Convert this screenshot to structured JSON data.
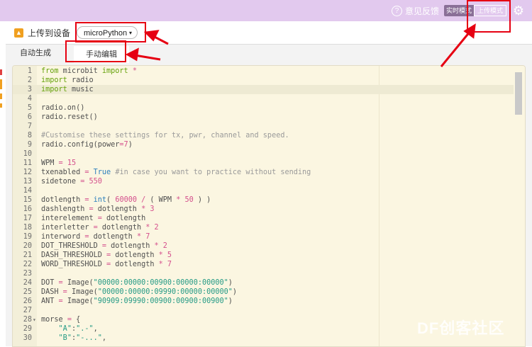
{
  "topbar": {
    "feedback_label": "意见反馈",
    "feedback_icon": "question-circle-icon",
    "mode_live_label": "实时模式",
    "mode_upload_label": "上传模式",
    "settings_icon": "gear-icon",
    "background_color": "#e2c9ee"
  },
  "toolbar": {
    "upload_label": "上传到设备",
    "upload_icon": "upload-arrow-icon",
    "language_selected": "microPython",
    "language_caret": "▾"
  },
  "tabs": [
    {
      "label": "自动生成",
      "active": false
    },
    {
      "label": "手动编辑",
      "active": true
    }
  ],
  "editor": {
    "active_line": 3,
    "background_color": "#fbf6e1",
    "lines": [
      {
        "n": "1",
        "tokens": [
          [
            "kw",
            "from"
          ],
          [
            "pl",
            " microbit "
          ],
          [
            "kw",
            "import"
          ],
          [
            "pl",
            " "
          ],
          [
            "op",
            "*"
          ]
        ]
      },
      {
        "n": "2",
        "tokens": [
          [
            "kw",
            "import"
          ],
          [
            "pl",
            " radio"
          ]
        ]
      },
      {
        "n": "3",
        "tokens": [
          [
            "kw",
            "import"
          ],
          [
            "pl",
            " music"
          ]
        ]
      },
      {
        "n": "4",
        "tokens": []
      },
      {
        "n": "5",
        "tokens": [
          [
            "pl",
            "radio.on()"
          ]
        ]
      },
      {
        "n": "6",
        "tokens": [
          [
            "pl",
            "radio.reset()"
          ]
        ]
      },
      {
        "n": "7",
        "tokens": []
      },
      {
        "n": "8",
        "tokens": [
          [
            "cm",
            "#Customise these settings for tx, pwr, channel and speed."
          ]
        ]
      },
      {
        "n": "9",
        "tokens": [
          [
            "pl",
            "radio.config(power"
          ],
          [
            "op",
            "="
          ],
          [
            "num",
            "7"
          ],
          [
            "pl",
            ")"
          ]
        ]
      },
      {
        "n": "10",
        "tokens": []
      },
      {
        "n": "11",
        "tokens": [
          [
            "pl",
            "WPM "
          ],
          [
            "op",
            "="
          ],
          [
            "pl",
            " "
          ],
          [
            "num",
            "15"
          ]
        ]
      },
      {
        "n": "12",
        "tokens": [
          [
            "pl",
            "txenabled "
          ],
          [
            "op",
            "="
          ],
          [
            "pl",
            " "
          ],
          [
            "bi",
            "True"
          ],
          [
            "pl",
            " "
          ],
          [
            "cm",
            "#in case you want to practice without sending"
          ]
        ]
      },
      {
        "n": "13",
        "tokens": [
          [
            "pl",
            "sidetone "
          ],
          [
            "op",
            "="
          ],
          [
            "pl",
            " "
          ],
          [
            "num",
            "550"
          ]
        ]
      },
      {
        "n": "14",
        "tokens": []
      },
      {
        "n": "15",
        "tokens": [
          [
            "pl",
            "dotlength "
          ],
          [
            "op",
            "="
          ],
          [
            "pl",
            " "
          ],
          [
            "bi",
            "int"
          ],
          [
            "pl",
            "( "
          ],
          [
            "num",
            "60000"
          ],
          [
            "pl",
            " "
          ],
          [
            "op",
            "/"
          ],
          [
            "pl",
            " ( WPM "
          ],
          [
            "op",
            "*"
          ],
          [
            "pl",
            " "
          ],
          [
            "num",
            "50"
          ],
          [
            "pl",
            " ) )"
          ]
        ]
      },
      {
        "n": "16",
        "tokens": [
          [
            "pl",
            "dashlength "
          ],
          [
            "op",
            "="
          ],
          [
            "pl",
            " dotlength "
          ],
          [
            "op",
            "*"
          ],
          [
            "pl",
            " "
          ],
          [
            "num",
            "3"
          ]
        ]
      },
      {
        "n": "17",
        "tokens": [
          [
            "pl",
            "interelement "
          ],
          [
            "op",
            "="
          ],
          [
            "pl",
            " dotlength"
          ]
        ]
      },
      {
        "n": "18",
        "tokens": [
          [
            "pl",
            "interletter "
          ],
          [
            "op",
            "="
          ],
          [
            "pl",
            " dotlength "
          ],
          [
            "op",
            "*"
          ],
          [
            "pl",
            " "
          ],
          [
            "num",
            "2"
          ]
        ]
      },
      {
        "n": "19",
        "tokens": [
          [
            "pl",
            "interword "
          ],
          [
            "op",
            "="
          ],
          [
            "pl",
            " dotlength "
          ],
          [
            "op",
            "*"
          ],
          [
            "pl",
            " "
          ],
          [
            "num",
            "7"
          ]
        ]
      },
      {
        "n": "20",
        "tokens": [
          [
            "pl",
            "DOT_THRESHOLD "
          ],
          [
            "op",
            "="
          ],
          [
            "pl",
            " dotlength "
          ],
          [
            "op",
            "*"
          ],
          [
            "pl",
            " "
          ],
          [
            "num",
            "2"
          ]
        ]
      },
      {
        "n": "21",
        "tokens": [
          [
            "pl",
            "DASH_THRESHOLD "
          ],
          [
            "op",
            "="
          ],
          [
            "pl",
            " dotlength "
          ],
          [
            "op",
            "*"
          ],
          [
            "pl",
            " "
          ],
          [
            "num",
            "5"
          ]
        ]
      },
      {
        "n": "22",
        "tokens": [
          [
            "pl",
            "WORD_THRESHOLD "
          ],
          [
            "op",
            "="
          ],
          [
            "pl",
            " dotlength "
          ],
          [
            "op",
            "*"
          ],
          [
            "pl",
            " "
          ],
          [
            "num",
            "7"
          ]
        ]
      },
      {
        "n": "23",
        "tokens": []
      },
      {
        "n": "24",
        "tokens": [
          [
            "pl",
            "DOT "
          ],
          [
            "op",
            "="
          ],
          [
            "pl",
            " Image("
          ],
          [
            "str",
            "\"00000:00000:00900:00000:00000\""
          ],
          [
            "pl",
            ")"
          ]
        ]
      },
      {
        "n": "25",
        "tokens": [
          [
            "pl",
            "DASH "
          ],
          [
            "op",
            "="
          ],
          [
            "pl",
            " Image("
          ],
          [
            "str",
            "\"00000:00000:09990:00000:00000\""
          ],
          [
            "pl",
            ")"
          ]
        ]
      },
      {
        "n": "26",
        "tokens": [
          [
            "pl",
            "ANT "
          ],
          [
            "op",
            "="
          ],
          [
            "pl",
            " Image("
          ],
          [
            "str",
            "\"90909:09990:00900:00900:00900\""
          ],
          [
            "pl",
            ")"
          ]
        ]
      },
      {
        "n": "27",
        "tokens": []
      },
      {
        "n": "28",
        "fold": "▾",
        "tokens": [
          [
            "pl",
            "morse "
          ],
          [
            "op",
            "="
          ],
          [
            "pl",
            " {"
          ]
        ]
      },
      {
        "n": "29",
        "tokens": [
          [
            "pl",
            "    "
          ],
          [
            "str",
            "\"A\""
          ],
          [
            "pl",
            ":"
          ],
          [
            "str",
            "\".-\""
          ],
          [
            "pl",
            ","
          ]
        ]
      },
      {
        "n": "30",
        "tokens": [
          [
            "pl",
            "    "
          ],
          [
            "str",
            "\"B\""
          ],
          [
            "pl",
            ":"
          ],
          [
            "str",
            "\"-...\""
          ],
          [
            "pl",
            ","
          ]
        ]
      }
    ]
  },
  "watermark": "DF创客社区",
  "annotation_color": "#e60012"
}
